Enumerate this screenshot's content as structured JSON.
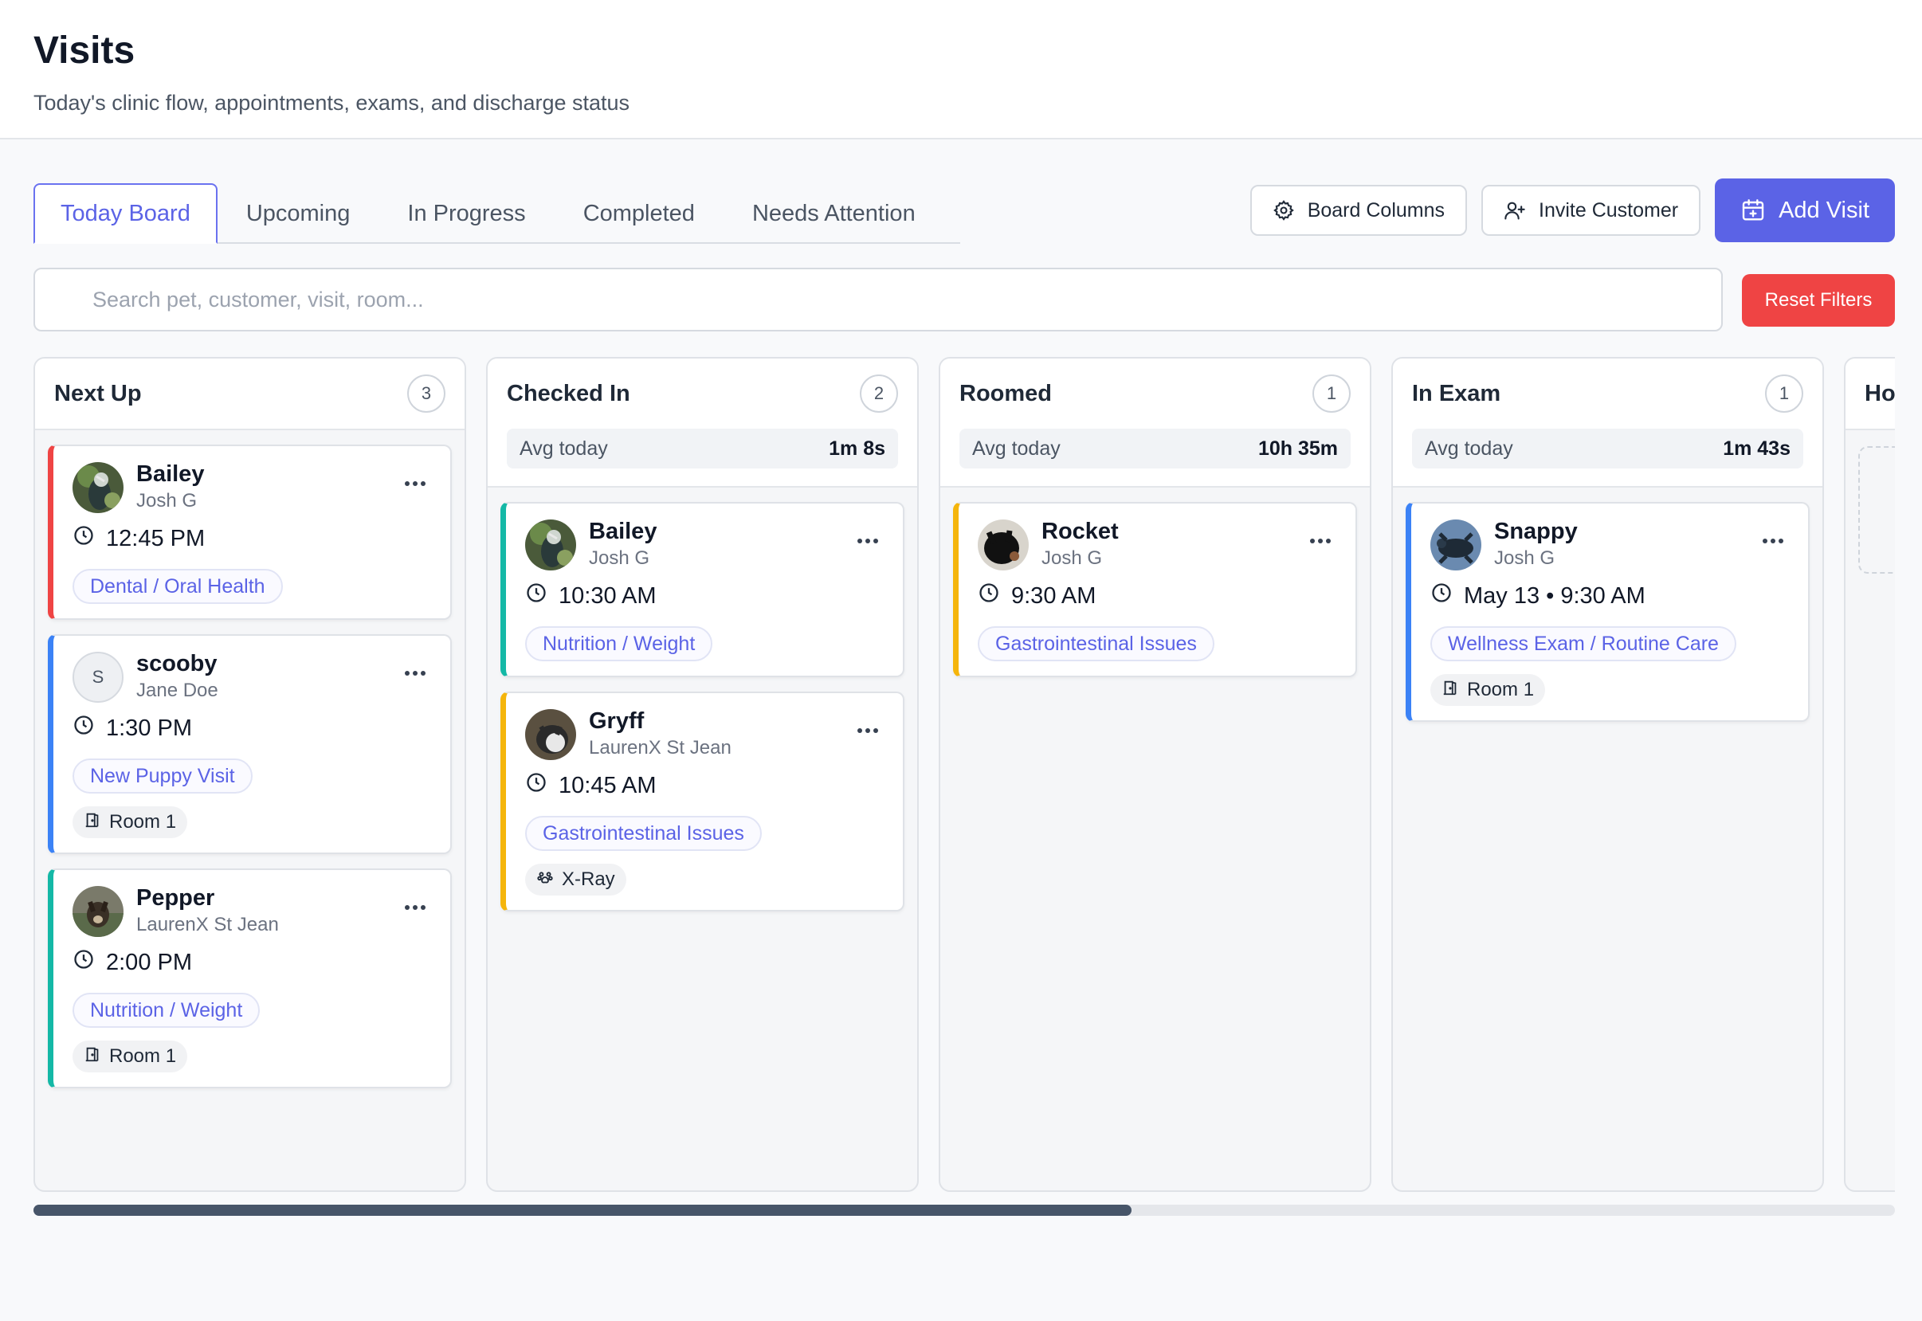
{
  "header": {
    "title": "Visits",
    "subtitle": "Today's clinic flow, appointments, exams, and discharge status"
  },
  "tabs": [
    {
      "label": "Today Board",
      "active": true
    },
    {
      "label": "Upcoming",
      "active": false
    },
    {
      "label": "In Progress",
      "active": false
    },
    {
      "label": "Completed",
      "active": false
    },
    {
      "label": "Needs Attention",
      "active": false
    }
  ],
  "actions": {
    "board_columns": "Board Columns",
    "invite_customer": "Invite Customer",
    "add_visit": "Add Visit"
  },
  "search": {
    "placeholder": "Search pet, customer, visit, room...",
    "value": ""
  },
  "reset_filters": "Reset Filters",
  "colors": {
    "accent": "#5b63e6",
    "danger": "#ef4444",
    "status_red": "#ef4444",
    "status_blue": "#3b82f6",
    "status_teal": "#14b8a6",
    "status_amber": "#f5b50b"
  },
  "columns": [
    {
      "title": "Next Up",
      "count": "3",
      "avg_label": "",
      "avg_value": "",
      "cards": [
        {
          "pet": "Bailey",
          "owner": "Josh G",
          "time": "12:45 PM",
          "tag": "Dental / Oral Health",
          "chip": "",
          "color": "red",
          "avatar": "photo-bird"
        },
        {
          "pet": "scooby",
          "owner": "Jane Doe",
          "time": "1:30 PM",
          "tag": "New Puppy Visit",
          "chip": "Room 1",
          "color": "blue",
          "avatar": "S"
        },
        {
          "pet": "Pepper",
          "owner": "LaurenX St Jean",
          "time": "2:00 PM",
          "tag": "Nutrition / Weight",
          "chip": "Room 1",
          "color": "teal",
          "avatar": "photo-dog"
        }
      ]
    },
    {
      "title": "Checked In",
      "count": "2",
      "avg_label": "Avg today",
      "avg_value": "1m 8s",
      "cards": [
        {
          "pet": "Bailey",
          "owner": "Josh G",
          "time": "10:30 AM",
          "tag": "Nutrition / Weight",
          "chip": "",
          "color": "teal",
          "avatar": "photo-bird"
        },
        {
          "pet": "Gryff",
          "owner": "LaurenX St Jean",
          "time": "10:45 AM",
          "tag": "Gastrointestinal Issues",
          "chip": "X-Ray",
          "color": "amber",
          "avatar": "photo-cat"
        }
      ]
    },
    {
      "title": "Roomed",
      "count": "1",
      "avg_label": "Avg today",
      "avg_value": "10h 35m",
      "cards": [
        {
          "pet": "Rocket",
          "owner": "Josh G",
          "time": "9:30 AM",
          "tag": "Gastrointestinal Issues",
          "chip": "",
          "color": "amber",
          "avatar": "photo-black"
        }
      ]
    },
    {
      "title": "In Exam",
      "count": "1",
      "avg_label": "Avg today",
      "avg_value": "1m 43s",
      "cards": [
        {
          "pet": "Snappy",
          "owner": "Josh G",
          "time": "May 13 • 9:30 AM",
          "tag": "Wellness Exam / Routine Care",
          "chip": "Room 1",
          "color": "blue",
          "avatar": "photo-turtle"
        }
      ]
    },
    {
      "title": "Ho",
      "count": "",
      "avg_label": "",
      "avg_value": "",
      "cards": []
    }
  ],
  "scroll": {
    "position_fraction": 0.59
  }
}
